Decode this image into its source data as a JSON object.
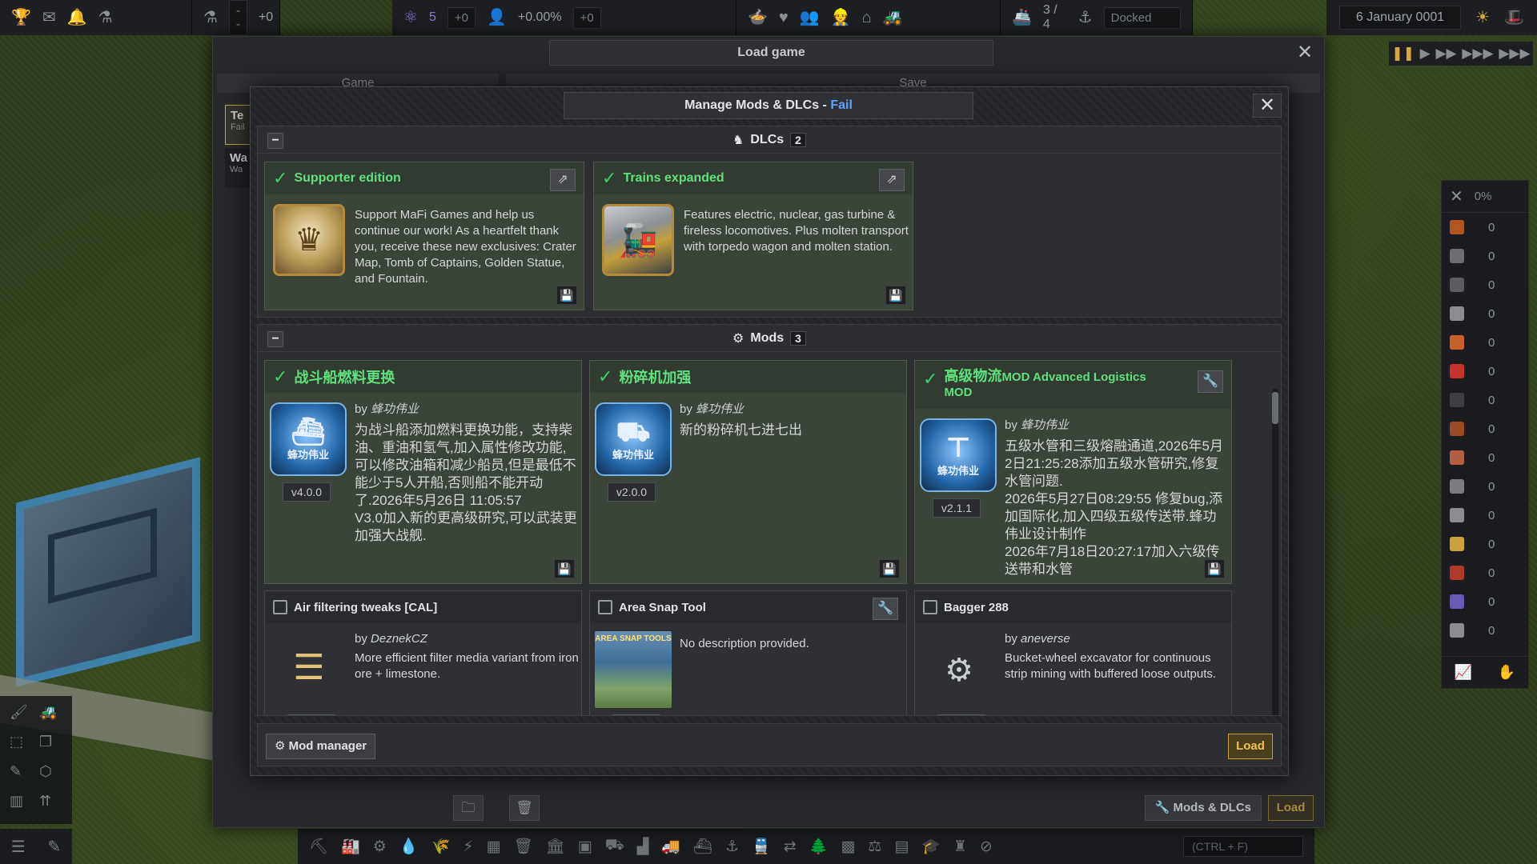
{
  "hud": {
    "placeholder_dash": "--",
    "delta_zero_1": "+0",
    "unity_value": "5",
    "delta_zero_2": "+0",
    "pop_growth": "+0.00%",
    "delta_zero_3": "+0",
    "ships": "3 / 4",
    "ship_status": "Docked",
    "date": "6 January 0001"
  },
  "load_dialog": {
    "title": "Load game",
    "col_game": "Game",
    "col_save": "Save",
    "saves": [
      {
        "name": "Te",
        "sub": "Fail"
      },
      {
        "name": "Wa",
        "sub": "Wa"
      }
    ],
    "mods_dlcs_label": "Mods & DLCs",
    "load_label": "Load"
  },
  "mods_dialog": {
    "title": "Manage Mods & DLCs - ",
    "title_status": "Fail",
    "dlc_section": {
      "label": "DLCs",
      "count": "2"
    },
    "mods_section": {
      "label": "Mods",
      "count": "3"
    },
    "dlcs": [
      {
        "title": "Supporter edition",
        "enabled": true,
        "desc": "Support MaFi Games and help us continue our work! As a heartfelt thank you, receive these new exclusives: Crater Map, Tomb of Captains, Golden Statue, and Fountain."
      },
      {
        "title": "Trains expanded",
        "enabled": true,
        "desc": "Features electric, nuclear, gas turbine & fireless locomotives. Plus molten transport with torpedo wagon and molten station."
      }
    ],
    "mods": [
      {
        "title": "战斗船燃料更换",
        "enabled": true,
        "by": "by",
        "author": "蜂功伟业",
        "version": "v4.0.0",
        "thumb_text": "蜂功伟业",
        "desc": "为战斗船添加燃料更换功能，支持柴油、重油和氢气,加入属性修改功能,可以修改油箱和减少船员,但是最低不能少于5人开船,否则船不能开动了.2026年5月26日 11:05:57\nV3.0加入新的更高级研究,可以武装更加强大战舰."
      },
      {
        "title": "粉碎机加强",
        "enabled": true,
        "by": "by",
        "author": "蜂功伟业",
        "version": "v2.0.0",
        "thumb_text": "蜂功伟业",
        "desc": "新的粉碎机七进七出"
      },
      {
        "title": "高级物流",
        "title_suffix": "MOD Advanced Logistics MOD",
        "enabled": true,
        "by": "by",
        "author": "蜂功伟业",
        "version": "v2.1.1",
        "thumb_text": "蜂功伟业",
        "desc": "五级水管和三级熔融通道,2026年5月2日21:25:28添加五级水管研究,修复水管问题.\n2026年5月27日08:29:55 修复bug,添加国际化,加入四级五级传送带.蜂功伟业设计制作\n2026年7月18日20:27:17加入六级传送带和水管"
      },
      {
        "title": "Air filtering tweaks [CAL]",
        "enabled": false,
        "by": "by",
        "author": "DeznekCZ",
        "desc": "More efficient filter media variant from iron ore + limestone."
      },
      {
        "title": "Area Snap Tool",
        "enabled": false,
        "desc": "No description provided.",
        "thumb_text": "AREA SNAP TOOLS"
      },
      {
        "title": "Bagger 288",
        "enabled": false,
        "by": "by",
        "author": "aneverse",
        "desc": "Bucket-wheel excavator for continuous strip mining with buffered loose outputs."
      }
    ],
    "mod_manager_label": "Mod manager",
    "load_label": "Load"
  },
  "resources": {
    "percent": "0%",
    "values": [
      "0",
      "0",
      "0",
      "0",
      "0",
      "0",
      "0",
      "0",
      "0",
      "0",
      "0",
      "0",
      "0",
      "0",
      "0"
    ],
    "colors": [
      "#b0581f",
      "#6d6f73",
      "#5a5c60",
      "#8a8c90",
      "#c4622a",
      "#c8302a",
      "#3d3f43",
      "#9a4a24",
      "#b06040",
      "#7a7c80",
      "#8a8c90",
      "#c9a23a",
      "#b03a2a",
      "#6a5ab8",
      "#8a8c90"
    ]
  },
  "search": {
    "placeholder": "(CTRL + F)"
  }
}
